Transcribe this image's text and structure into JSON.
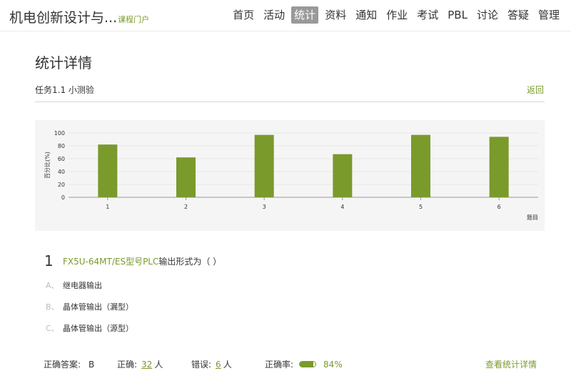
{
  "header": {
    "title": "机电创新设计与...",
    "subtitle": "课程门户",
    "nav": [
      {
        "label": "首页",
        "active": false
      },
      {
        "label": "活动",
        "active": false
      },
      {
        "label": "统计",
        "active": true
      },
      {
        "label": "资料",
        "active": false
      },
      {
        "label": "通知",
        "active": false
      },
      {
        "label": "作业",
        "active": false
      },
      {
        "label": "考试",
        "active": false
      },
      {
        "label": "PBL",
        "active": false
      },
      {
        "label": "讨论",
        "active": false
      },
      {
        "label": "答疑",
        "active": false
      },
      {
        "label": "管理",
        "active": false
      }
    ]
  },
  "page": {
    "title": "统计详情",
    "task_name": "任务1.1 小测验",
    "back_label": "返回"
  },
  "chart_data": {
    "type": "bar",
    "categories": [
      "1",
      "2",
      "3",
      "4",
      "5",
      "6"
    ],
    "values": [
      82,
      62,
      97,
      67,
      97,
      94
    ],
    "ylabel": "百分比(%)",
    "xlabel": "题目",
    "ylim": [
      0,
      100
    ],
    "yticks": [
      0,
      20,
      40,
      60,
      80,
      100
    ],
    "bar_color": "#7a9a2c",
    "grid": true
  },
  "question": {
    "number": "1",
    "model_text": "FX5U-64MT/ES型号PLC",
    "text": "输出形式为（ ）",
    "options": [
      {
        "letter": "A、",
        "text": "继电器输出"
      },
      {
        "letter": "B、",
        "text": "晶体管输出（漏型）"
      },
      {
        "letter": "C、",
        "text": "晶体管输出（源型）"
      }
    ]
  },
  "stats": {
    "answer_label": "正确答案:",
    "answer_value": "B",
    "correct_label": "正确:",
    "correct_count": "32",
    "correct_unit": "人",
    "wrong_label": "错误:",
    "wrong_count": "6",
    "wrong_unit": "人",
    "rate_label": "正确率:",
    "rate_value": "84%",
    "rate_fraction": 0.84,
    "detail_link": "查看统计详情"
  },
  "colors": {
    "accent": "#7a9a2c"
  }
}
